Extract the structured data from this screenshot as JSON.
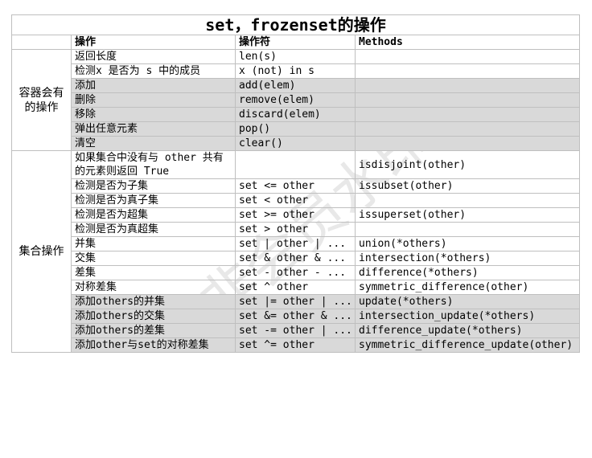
{
  "title": "set，frozenset的操作",
  "headers": [
    "操作",
    "操作符",
    "Methods"
  ],
  "groups": {
    "container": "容器会有的操作",
    "set_ops": "集合操作"
  },
  "rows": [
    {
      "op": "返回长度",
      "sym": "len(s)",
      "method": ""
    },
    {
      "op": "检测x 是否为 s 中的成员",
      "sym": "x (not) in s",
      "method": ""
    },
    {
      "op": "添加",
      "sym": "add(elem)",
      "method": ""
    },
    {
      "op": "删除",
      "sym": "remove(elem)",
      "method": ""
    },
    {
      "op": "移除",
      "sym": "discard(elem)",
      "method": ""
    },
    {
      "op": "弹出任意元素",
      "sym": "pop()",
      "method": ""
    },
    {
      "op": "清空",
      "sym": "clear()",
      "method": ""
    },
    {
      "op": "如果集合中没有与 other 共有的元素则返回 True",
      "sym": "",
      "method": "isdisjoint(other)"
    },
    {
      "op": "检测是否为子集",
      "sym": "set <= other",
      "method": "issubset(other)"
    },
    {
      "op": "检测是否为真子集",
      "sym": "set < other",
      "method": ""
    },
    {
      "op": "检测是否为超集",
      "sym": "set >= other",
      "method": "issuperset(other)"
    },
    {
      "op": "检测是否为真超集",
      "sym": "set > other",
      "method": ""
    },
    {
      "op": "并集",
      "sym": "set | other | ...",
      "method": "union(*others)"
    },
    {
      "op": "交集",
      "sym": "set & other & ...",
      "method": "intersection(*others)"
    },
    {
      "op": "差集",
      "sym": "set - other - ...",
      "method": "difference(*others)"
    },
    {
      "op": "对称差集",
      "sym": "set ^ other",
      "method": "symmetric_difference(other)"
    },
    {
      "op": "添加others的并集",
      "sym": "set |= other | ...",
      "method": "update(*others)"
    },
    {
      "op": "添加others的交集",
      "sym": "set &= other & ...",
      "method": "intersection_update(*others)"
    },
    {
      "op": "添加others的差集",
      "sym": "set -= other | ...",
      "method": "difference_update(*others)"
    },
    {
      "op": "添加other与set的对称差集",
      "sym": "set ^= other",
      "method": "symmetric_difference_update(other)"
    }
  ],
  "watermark": "非会员水印",
  "colors": {
    "shade": "#d9d9d9",
    "border": "#bfbfbf"
  }
}
